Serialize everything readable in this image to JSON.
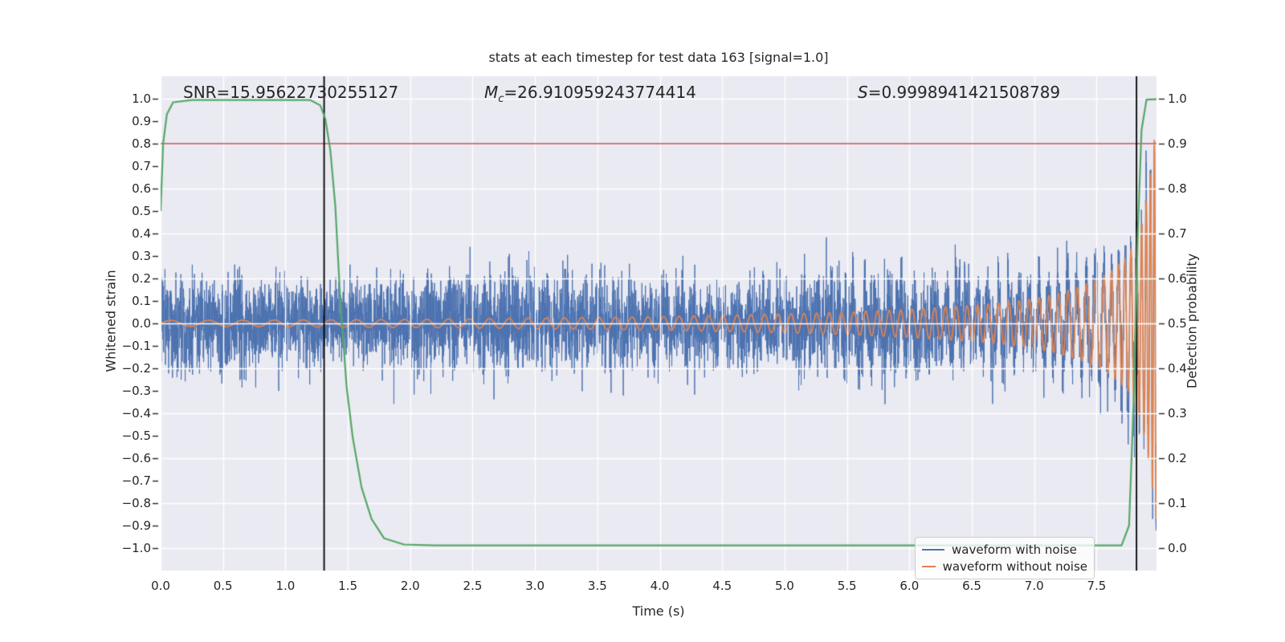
{
  "title": "stats at each timestep for test data 163 [signal=1.0]",
  "annotations": {
    "snr": "SNR=15.95622730255127",
    "mc_symbol": "M",
    "mc_subscript": "c",
    "mc_value": "=26.910959243774414",
    "s_symbol": "S",
    "s_value": "=0.9998941421508789"
  },
  "colors": {
    "background": "#eaeaf2",
    "grid": "#ffffff",
    "text": "#262626",
    "blue": "#4c72b0",
    "orange": "#dd8452",
    "green": "#55a868",
    "red": "#c44e52",
    "vline": "#000000"
  },
  "axes": {
    "x": {
      "label": "Time (s)",
      "tick_values": [
        0.0,
        0.5,
        1.0,
        1.5,
        2.0,
        2.5,
        3.0,
        3.5,
        4.0,
        4.5,
        5.0,
        5.5,
        6.0,
        6.5,
        7.0,
        7.5
      ],
      "tick_labels": [
        "0.0",
        "0.5",
        "1.0",
        "1.5",
        "2.0",
        "2.5",
        "3.0",
        "3.5",
        "4.0",
        "4.5",
        "5.0",
        "5.5",
        "6.0",
        "6.5",
        "7.0",
        "7.5"
      ]
    },
    "y_left": {
      "label": "Whitened strain",
      "tick_values": [
        1.0,
        0.9,
        0.8,
        0.7,
        0.6,
        0.5,
        0.4,
        0.3,
        0.2,
        0.1,
        0.0,
        -0.1,
        -0.2,
        -0.3,
        -0.4,
        -0.5,
        -0.6,
        -0.7,
        -0.8,
        -0.9,
        -1.0
      ],
      "tick_labels": [
        "1.0",
        "0.9",
        "0.8",
        "0.7",
        "0.6",
        "0.5",
        "0.4",
        "0.3",
        "0.2",
        "0.1",
        "0.0",
        "−0.1",
        "−0.2",
        "−0.3",
        "−0.4",
        "−0.5",
        "−0.6",
        "−0.7",
        "−0.8",
        "−0.9",
        "−1.0"
      ]
    },
    "y_right": {
      "label": "Detection probability",
      "tick_values": [
        1.0,
        0.9,
        0.8,
        0.7,
        0.6,
        0.5,
        0.4,
        0.3,
        0.2,
        0.1,
        0.0
      ],
      "tick_labels": [
        "1.0",
        "0.9",
        "0.8",
        "0.7",
        "0.6",
        "0.5",
        "0.4",
        "0.3",
        "0.2",
        "0.1",
        "0.0"
      ]
    }
  },
  "legend": {
    "entries": [
      {
        "label": "waveform with noise",
        "color_key": "blue"
      },
      {
        "label": "waveform without noise",
        "color_key": "orange"
      }
    ]
  },
  "chart_data": {
    "type": "line",
    "title": "stats at each timestep for test data 163 [signal=1.0]",
    "xlabel": "Time (s)",
    "ylabel_left": "Whitened strain",
    "ylabel_right": "Detection probability",
    "xlim": [
      0,
      7.98
    ],
    "ylim_left": [
      -1.1,
      1.1
    ],
    "ylim_right": [
      -0.05,
      1.05
    ],
    "grid": true,
    "legend_position": "lower right",
    "stats": {
      "SNR": 15.95622730255127,
      "Mc": 26.910959243774414,
      "S": 0.9998941421508789,
      "signal": 1.0,
      "test_data_index": 163
    },
    "series": [
      {
        "name": "waveform with noise",
        "axis": "left",
        "color_key": "blue",
        "model": "gaussian_noise_plus_signal",
        "noise_sigma_estimate": 0.1,
        "typical_band": [
          -0.2,
          0.2
        ],
        "peak_excursion": 0.45
      },
      {
        "name": "waveform without noise",
        "axis": "left",
        "color_key": "orange",
        "model": "chirp",
        "envelope_t_amp": [
          [
            0,
            0.013
          ],
          [
            1,
            0.015
          ],
          [
            2,
            0.018
          ],
          [
            3,
            0.023
          ],
          [
            4,
            0.03
          ],
          [
            5,
            0.042
          ],
          [
            5.5,
            0.05
          ],
          [
            6,
            0.062
          ],
          [
            6.5,
            0.08
          ],
          [
            6.8,
            0.095
          ],
          [
            7.0,
            0.11
          ],
          [
            7.2,
            0.135
          ],
          [
            7.4,
            0.17
          ],
          [
            7.6,
            0.225
          ],
          [
            7.75,
            0.3
          ],
          [
            7.85,
            0.42
          ],
          [
            7.9,
            0.55
          ],
          [
            7.94,
            0.7
          ],
          [
            7.97,
            0.86
          ],
          [
            7.98,
            0.88
          ]
        ],
        "freq_hz_t_f": [
          [
            0,
            3.0
          ],
          [
            2,
            5.5
          ],
          [
            4,
            8.0
          ],
          [
            6,
            11.0
          ],
          [
            7,
            12.5
          ],
          [
            7.5,
            14.0
          ],
          [
            7.8,
            22.0
          ],
          [
            7.95,
            32.0
          ],
          [
            7.98,
            36.0
          ]
        ]
      },
      {
        "name": "detection probability",
        "axis": "right",
        "color_key": "green",
        "points_t_p": [
          [
            0,
            0.75
          ],
          [
            0.02,
            0.9
          ],
          [
            0.05,
            0.965
          ],
          [
            0.1,
            0.992
          ],
          [
            0.25,
            0.997
          ],
          [
            1.2,
            0.997
          ],
          [
            1.28,
            0.985
          ],
          [
            1.32,
            0.955
          ],
          [
            1.36,
            0.885
          ],
          [
            1.4,
            0.76
          ],
          [
            1.44,
            0.55
          ],
          [
            1.49,
            0.36
          ],
          [
            1.54,
            0.245
          ],
          [
            1.61,
            0.135
          ],
          [
            1.69,
            0.065
          ],
          [
            1.79,
            0.022
          ],
          [
            1.95,
            0.008
          ],
          [
            2.2,
            0.006
          ],
          [
            7.7,
            0.006
          ],
          [
            7.76,
            0.05
          ],
          [
            7.8,
            0.35
          ],
          [
            7.83,
            0.7
          ],
          [
            7.86,
            0.93
          ],
          [
            7.9,
            0.998
          ],
          [
            7.98,
            0.999
          ]
        ]
      },
      {
        "name": "detection threshold",
        "axis": "right",
        "color_key": "red",
        "hline_value": 0.9
      },
      {
        "name": "event markers",
        "color_key": "vline",
        "vline_times": [
          1.31,
          7.82
        ]
      }
    ]
  }
}
